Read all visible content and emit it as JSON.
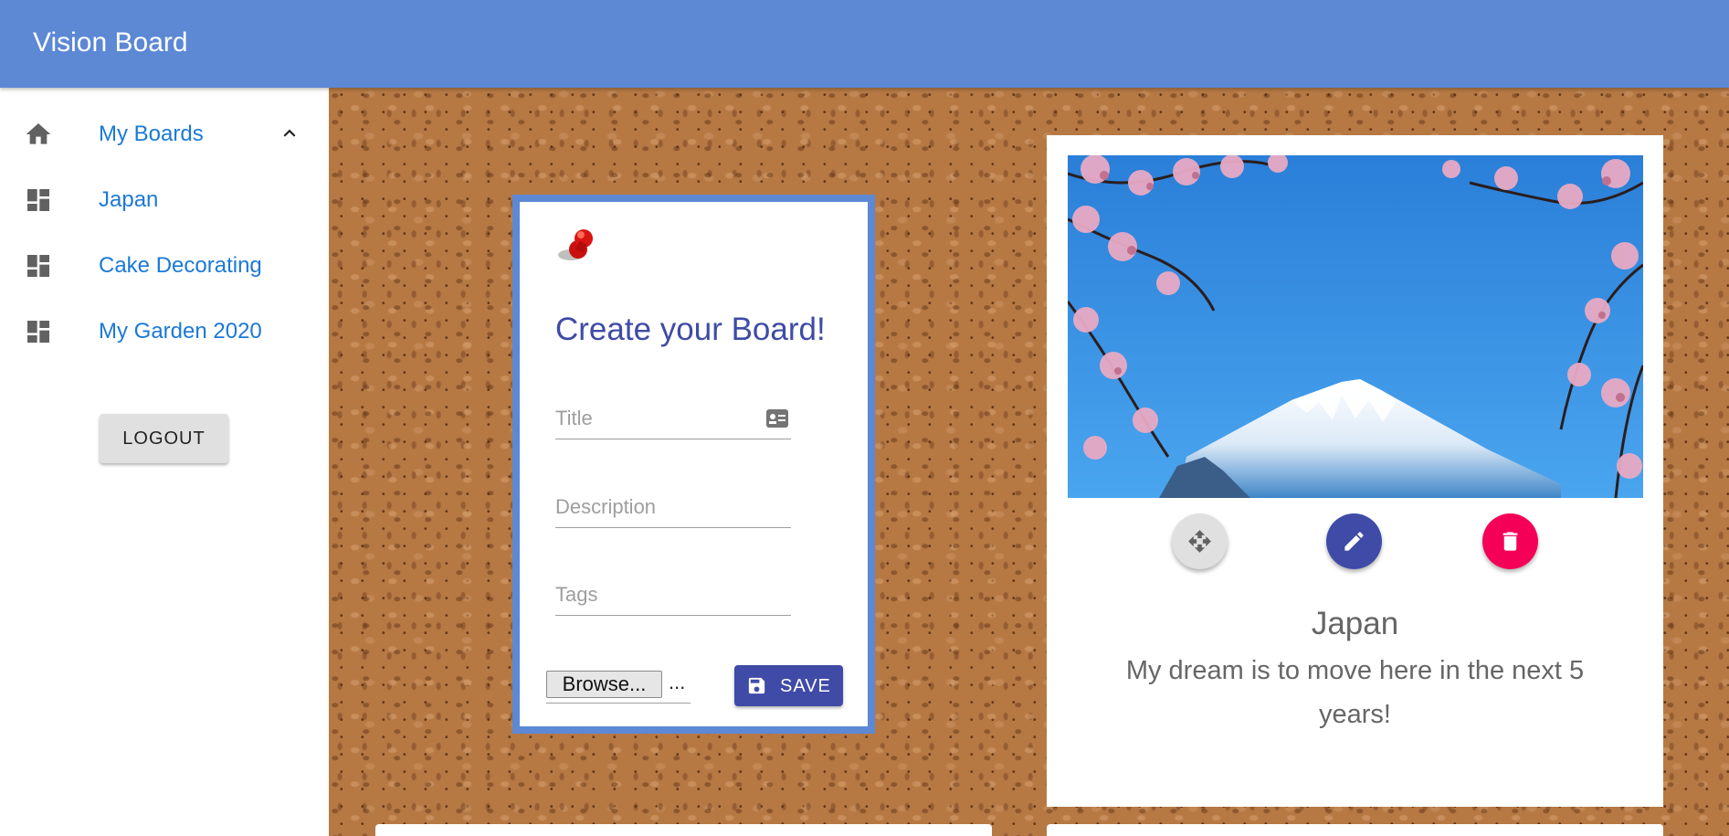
{
  "app": {
    "title": "Vision Board",
    "brand_color": "#5c88d4"
  },
  "sidebar": {
    "items": [
      {
        "label": "My Boards",
        "icon": "home-icon",
        "expanded": true
      },
      {
        "label": "Japan",
        "icon": "dashboard-icon"
      },
      {
        "label": "Cake Decorating",
        "icon": "dashboard-icon"
      },
      {
        "label": "My Garden 2020",
        "icon": "dashboard-icon"
      }
    ],
    "logout_label": "LOGOUT",
    "link_color": "#1b79d6"
  },
  "create_form": {
    "title": "Create your Board!",
    "title_placeholder": "Title",
    "description_placeholder": "Description",
    "tags_placeholder": "Tags",
    "browse_label": "Browse...",
    "file_value": "...",
    "save_label": "SAVE",
    "accent_color": "#3f4ba6"
  },
  "boards": [
    {
      "title": "Japan",
      "description": "My dream is to move here in the next 5 years!",
      "image": "mount-fuji-cherry-blossom",
      "actions": [
        "move-icon",
        "edit-icon",
        "delete-icon"
      ],
      "delete_color": "#f50057"
    }
  ]
}
